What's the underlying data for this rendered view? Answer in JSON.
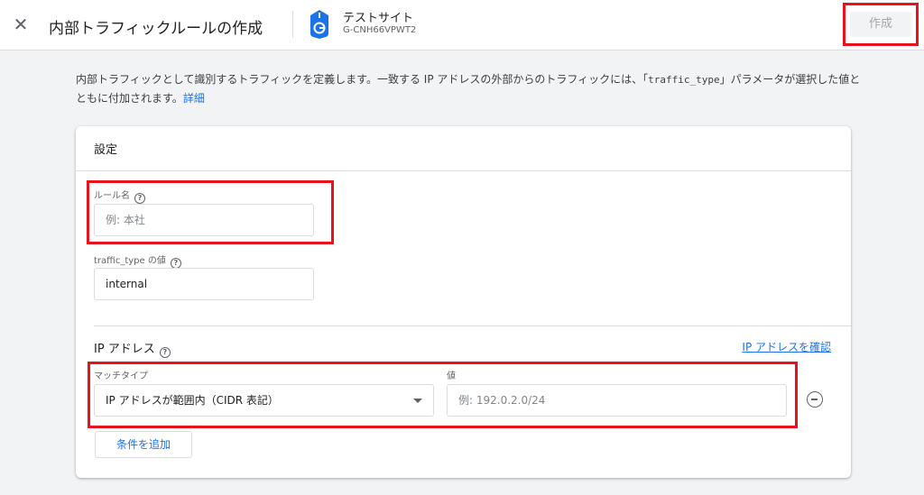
{
  "header": {
    "close_icon": "close-icon",
    "title": "内部トラフィックルールの作成",
    "property_icon": "google-analytics-tag-icon",
    "property_name": "テストサイト",
    "property_id": "G-CNH66VPWT2",
    "create_label": "作成"
  },
  "intro": {
    "text_before": "内部トラフィックとして識別するトラフィックを定義します。一致する IP アドレスの外部からのトラフィックには、「",
    "code": "traffic_type",
    "text_after": "」パラメータが選択した値とともに付加されます。",
    "link": "詳細"
  },
  "card": {
    "title": "設定",
    "rule_name": {
      "label": "ルール名",
      "placeholder": "例: 本社",
      "value": ""
    },
    "traffic_type": {
      "label": "traffic_type の値",
      "value": "internal"
    },
    "ip_section": {
      "title": "IP アドレス",
      "verify_link": "IP アドレスを確認",
      "match_type_label": "マッチタイプ",
      "match_type_value": "IP アドレスが範囲内（CIDR 表記）",
      "value_label": "値",
      "value_placeholder": "例: 192.0.2.0/24",
      "remove_icon": "remove-circle-icon",
      "add_condition": "条件を追加"
    }
  },
  "colors": {
    "highlight": "#e8121c",
    "link": "#1a73e8",
    "background": "#f1f3f4"
  }
}
